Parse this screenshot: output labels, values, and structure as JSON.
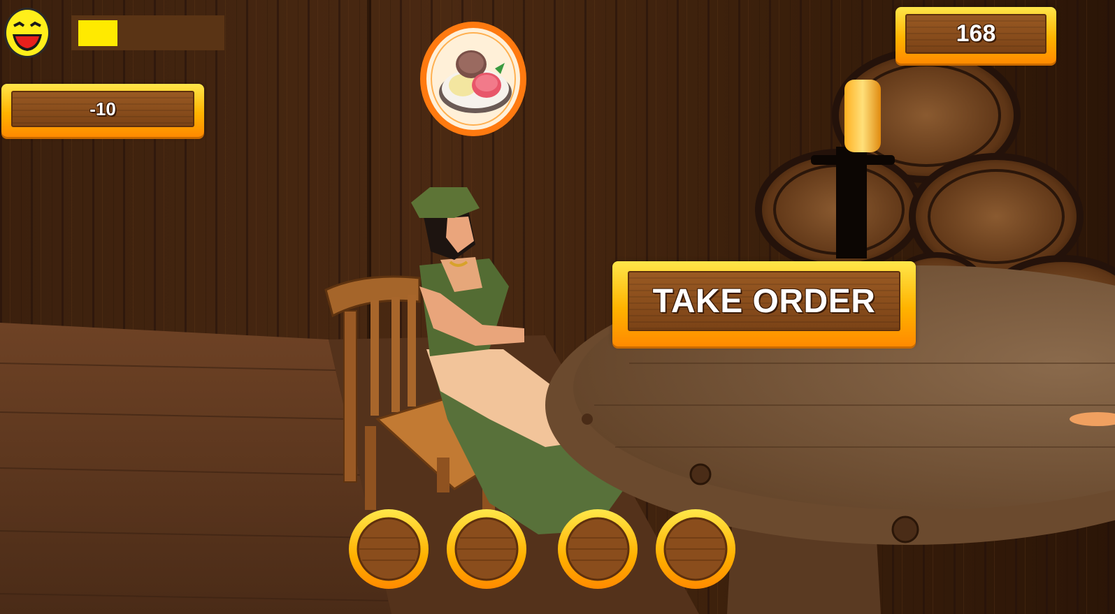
{
  "hud": {
    "mood": {
      "icon": "laughing-face-icon",
      "level": 0.28,
      "fill_color": "#ffea00"
    },
    "score_change": "-10",
    "coins": "168"
  },
  "order": {
    "icon": "ice-cream-bowl-icon",
    "bubble_color": "#ff7a10"
  },
  "actions": {
    "take_order_label": "TAKE ORDER"
  },
  "inventory": {
    "slots": [
      {
        "item": ""
      },
      {
        "item": ""
      },
      {
        "item": ""
      },
      {
        "item": ""
      }
    ]
  }
}
